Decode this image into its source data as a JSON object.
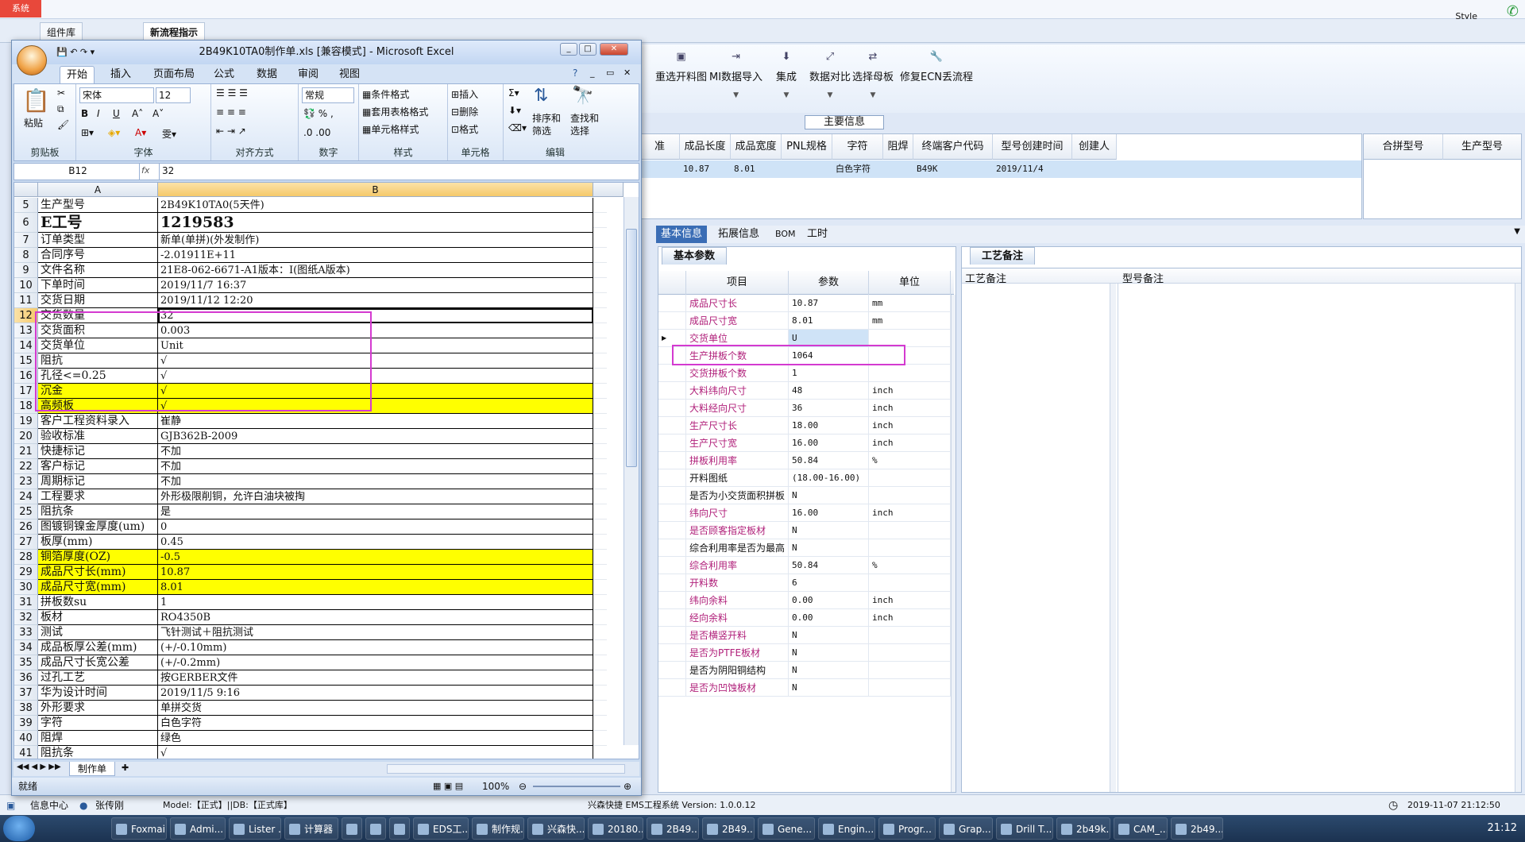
{
  "bg": {
    "sys_label": "系统",
    "style_label": "Style",
    "tabs": [
      "组件库",
      "新流程指示"
    ],
    "ribbon": [
      {
        "label": "重选开料图",
        "icon": "▣",
        "dropdown": false
      },
      {
        "label": "MI数据导入",
        "icon": "⇥",
        "dropdown": true
      },
      {
        "label": "集成",
        "icon": "⬇",
        "dropdown": true
      },
      {
        "label": "数据对比",
        "icon": "⤢",
        "dropdown": true
      },
      {
        "label": "选择母板",
        "icon": "⇄",
        "dropdown": true
      },
      {
        "label": "修复ECN丢流程",
        "icon": "🔧",
        "dropdown": false
      }
    ],
    "section_title": "主要信息",
    "grid_headers": [
      "准",
      "成品长度",
      "成品宽度",
      "PNL规格",
      "字符",
      "阻焊",
      "终端客户代码",
      "型号创建时间",
      "创建人"
    ],
    "grid_row": [
      "",
      "10.87",
      "8.01",
      "",
      "白色字符",
      "",
      "B49K",
      "2019/11/4",
      ""
    ],
    "grid2_headers": [
      "合拼型号",
      "生产型号"
    ],
    "sub_tabs": [
      "基本信息",
      "拓展信息",
      "BOM",
      "工时"
    ],
    "basic_tab": "基本参数",
    "craft_tab": "工艺备注",
    "param_headers": [
      "项目",
      "参数",
      "单位"
    ],
    "params": [
      {
        "item": "成品尺寸长",
        "value": "10.87",
        "unit": "mm",
        "pink": true
      },
      {
        "item": "成品尺寸宽",
        "value": "8.01",
        "unit": "mm",
        "pink": true
      },
      {
        "item": "交货单位",
        "value": "U",
        "unit": "",
        "pink": true,
        "sel": true
      },
      {
        "item": "生产拼板个数",
        "value": "1064",
        "unit": "",
        "pink": true
      },
      {
        "item": "交货拼板个数",
        "value": "1",
        "unit": "",
        "pink": true
      },
      {
        "item": "大料纬向尺寸",
        "value": "48",
        "unit": "inch",
        "pink": true
      },
      {
        "item": "大料经向尺寸",
        "value": "36",
        "unit": "inch",
        "pink": true
      },
      {
        "item": "生产尺寸长",
        "value": "18.00",
        "unit": "inch",
        "pink": true
      },
      {
        "item": "生产尺寸宽",
        "value": "16.00",
        "unit": "inch",
        "pink": true
      },
      {
        "item": "拼板利用率",
        "value": "50.84",
        "unit": "%",
        "pink": true
      },
      {
        "item": "开料图纸",
        "value": "(18.00-16.00)",
        "unit": "",
        "pink": false
      },
      {
        "item": "是否为小交货面积拼板",
        "value": "N",
        "unit": "",
        "pink": false
      },
      {
        "item": "纬向尺寸",
        "value": "16.00",
        "unit": "inch",
        "pink": true
      },
      {
        "item": "是否顾客指定板材",
        "value": "N",
        "unit": "",
        "pink": true
      },
      {
        "item": "综合利用率是否为最高",
        "value": "N",
        "unit": "",
        "pink": false
      },
      {
        "item": "综合利用率",
        "value": "50.84",
        "unit": "%",
        "pink": true
      },
      {
        "item": "开料数",
        "value": "6",
        "unit": "",
        "pink": true
      },
      {
        "item": "纬向余料",
        "value": "0.00",
        "unit": "inch",
        "pink": true
      },
      {
        "item": "经向余料",
        "value": "0.00",
        "unit": "inch",
        "pink": true
      },
      {
        "item": "是否横竖开料",
        "value": "N",
        "unit": "",
        "pink": true
      },
      {
        "item": "是否为PTFE板材",
        "value": "N",
        "unit": "",
        "pink": true
      },
      {
        "item": "是否为阴阳铜结构",
        "value": "N",
        "unit": "",
        "pink": false
      },
      {
        "item": "是否为凹蚀板材",
        "value": "N",
        "unit": "",
        "pink": true
      }
    ],
    "craft_cols": [
      "工艺备注",
      "型号备注"
    ],
    "status": {
      "info": "信息中心",
      "user": "张传刚",
      "model": "Model:【正式】||DB:【正式库】",
      "system": "兴森快捷 EMS工程系统 Version: 1.0.0.12",
      "datetime": "2019-11-07 21:12:50"
    }
  },
  "excel": {
    "title": "2B49K10TA0制作单.xls  [兼容模式] - Microsoft Excel",
    "tabs": [
      "开始",
      "插入",
      "页面布局",
      "公式",
      "数据",
      "审阅",
      "视图"
    ],
    "ribbon": {
      "paste": "粘贴",
      "clipboard": "剪贴板",
      "font_name": "宋体",
      "font_size": "12",
      "font_group": "字体",
      "align_group": "对齐方式",
      "num_format": "常规",
      "num_group": "数字",
      "cond_format": "条件格式",
      "table_format": "套用表格格式",
      "cell_style": "单元格样式",
      "style_group": "样式",
      "insert": "插入",
      "delete": "删除",
      "format": "格式",
      "cell_group": "单元格",
      "sort": "排序和",
      "sort2": "筛选",
      "find": "查找和",
      "find2": "选择",
      "edit_group": "编辑"
    },
    "namebox": "B12",
    "formula": "32",
    "col_a": "A",
    "col_b": "B",
    "rows": [
      {
        "n": "5",
        "a": "生产型号",
        "b": "2B49K10TA0(5天件)"
      },
      {
        "n": "6",
        "a": "E工号",
        "b": "1219583",
        "big": true
      },
      {
        "n": "7",
        "a": "订单类型",
        "b": "新单(单拼)(外发制作)"
      },
      {
        "n": "8",
        "a": "合同序号",
        "b": "-2.01911E+11"
      },
      {
        "n": "9",
        "a": "文件名称",
        "b": "21E8-062-6671-A1版本：Ⅰ(图纸A版本)"
      },
      {
        "n": "10",
        "a": "下单时间",
        "b": "2019/11/7 16:37"
      },
      {
        "n": "11",
        "a": "交货日期",
        "b": "2019/11/12 12:20"
      },
      {
        "n": "12",
        "a": "交货数量",
        "b": "32",
        "sel": true
      },
      {
        "n": "13",
        "a": "交货面积",
        "b": "0.003"
      },
      {
        "n": "14",
        "a": "交货单位",
        "b": "Unit"
      },
      {
        "n": "15",
        "a": "阻抗",
        "b": "√"
      },
      {
        "n": "16",
        "a": "孔径<=0.25",
        "b": "√"
      },
      {
        "n": "17",
        "a": "沉金",
        "b": "√",
        "yellow": true
      },
      {
        "n": "18",
        "a": "高频板",
        "b": "√",
        "yellow": true
      },
      {
        "n": "19",
        "a": "客户工程资料录入",
        "b": "崔静"
      },
      {
        "n": "20",
        "a": "验收标准",
        "b": "GJB362B-2009"
      },
      {
        "n": "21",
        "a": "快捷标记",
        "b": "不加"
      },
      {
        "n": "22",
        "a": "客户标记",
        "b": "不加"
      },
      {
        "n": "23",
        "a": "周期标记",
        "b": "不加"
      },
      {
        "n": "24",
        "a": "工程要求",
        "b": "外形极限削铜，允许白油块被掏"
      },
      {
        "n": "25",
        "a": "阻抗条",
        "b": "是"
      },
      {
        "n": "26",
        "a": "图镀铜镍金厚度(um)",
        "b": "0"
      },
      {
        "n": "27",
        "a": "板厚(mm)",
        "b": "0.45"
      },
      {
        "n": "28",
        "a": "铜箔厚度(OZ)",
        "b": "-0.5",
        "yellow": true
      },
      {
        "n": "29",
        "a": "成品尺寸长(mm)",
        "b": "10.87",
        "yellow": true
      },
      {
        "n": "30",
        "a": "成品尺寸宽(mm)",
        "b": "8.01",
        "yellow": true
      },
      {
        "n": "31",
        "a": "拼板数su",
        "b": "1"
      },
      {
        "n": "32",
        "a": "板材",
        "b": "RO4350B"
      },
      {
        "n": "33",
        "a": "测试",
        "b": "飞针测试＋阻抗测试"
      },
      {
        "n": "34",
        "a": "成品板厚公差(mm)",
        "b": "(+/-0.10mm)"
      },
      {
        "n": "35",
        "a": "成品尺寸长宽公差",
        "b": "(+/-0.2mm)"
      },
      {
        "n": "36",
        "a": "过孔工艺",
        "b": "按GERBER文件"
      },
      {
        "n": "37",
        "a": "华为设计时间",
        "b": "2019/11/5 9:16"
      },
      {
        "n": "38",
        "a": "外形要求",
        "b": "单拼交货"
      },
      {
        "n": "39",
        "a": "字符",
        "b": "白色字符"
      },
      {
        "n": "40",
        "a": "阻焊",
        "b": "绿色"
      },
      {
        "n": "41",
        "a": "阻抗条",
        "b": "√"
      }
    ],
    "sheet_tab": "制作单",
    "status_ready": "就绪",
    "zoom": "100%"
  },
  "taskbar": [
    "Foxmail",
    "Admi...",
    "Lister ...",
    "计算器",
    "",
    "",
    "",
    "EDS工...",
    "制作规...",
    "兴森快...",
    "20180...",
    "2B49...",
    "2B49...",
    "Gene...",
    "Engin...",
    "Progr...",
    "Grap...",
    "Drill T...",
    "2b49k...",
    "CAM_...",
    "2b49..."
  ],
  "clock": "21:12"
}
